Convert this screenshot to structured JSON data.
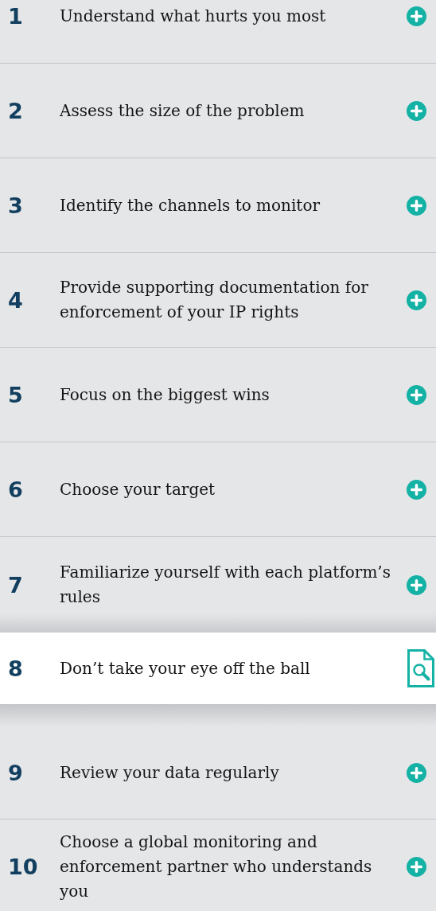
{
  "steps": [
    {
      "number": "1",
      "title": "Understand what hurts you most",
      "selected": false
    },
    {
      "number": "2",
      "title": "Assess the size of the problem",
      "selected": false
    },
    {
      "number": "3",
      "title": "Identify the channels to monitor",
      "selected": false
    },
    {
      "number": "4",
      "title": "Provide supporting documentation for enforcement of your IP rights",
      "selected": false
    },
    {
      "number": "5",
      "title": "Focus on the biggest wins",
      "selected": false
    },
    {
      "number": "6",
      "title": "Choose your target",
      "selected": false
    },
    {
      "number": "7",
      "title": "Familiarize yourself with each platform’s rules",
      "selected": false
    },
    {
      "number": "8",
      "title": "Don’t take your eye off the ball",
      "selected": true
    },
    {
      "number": "9",
      "title": "Review your data regularly",
      "selected": false
    },
    {
      "number": "10",
      "title": "Choose a global monitoring and enforcement partner who understands you",
      "selected": false
    }
  ]
}
